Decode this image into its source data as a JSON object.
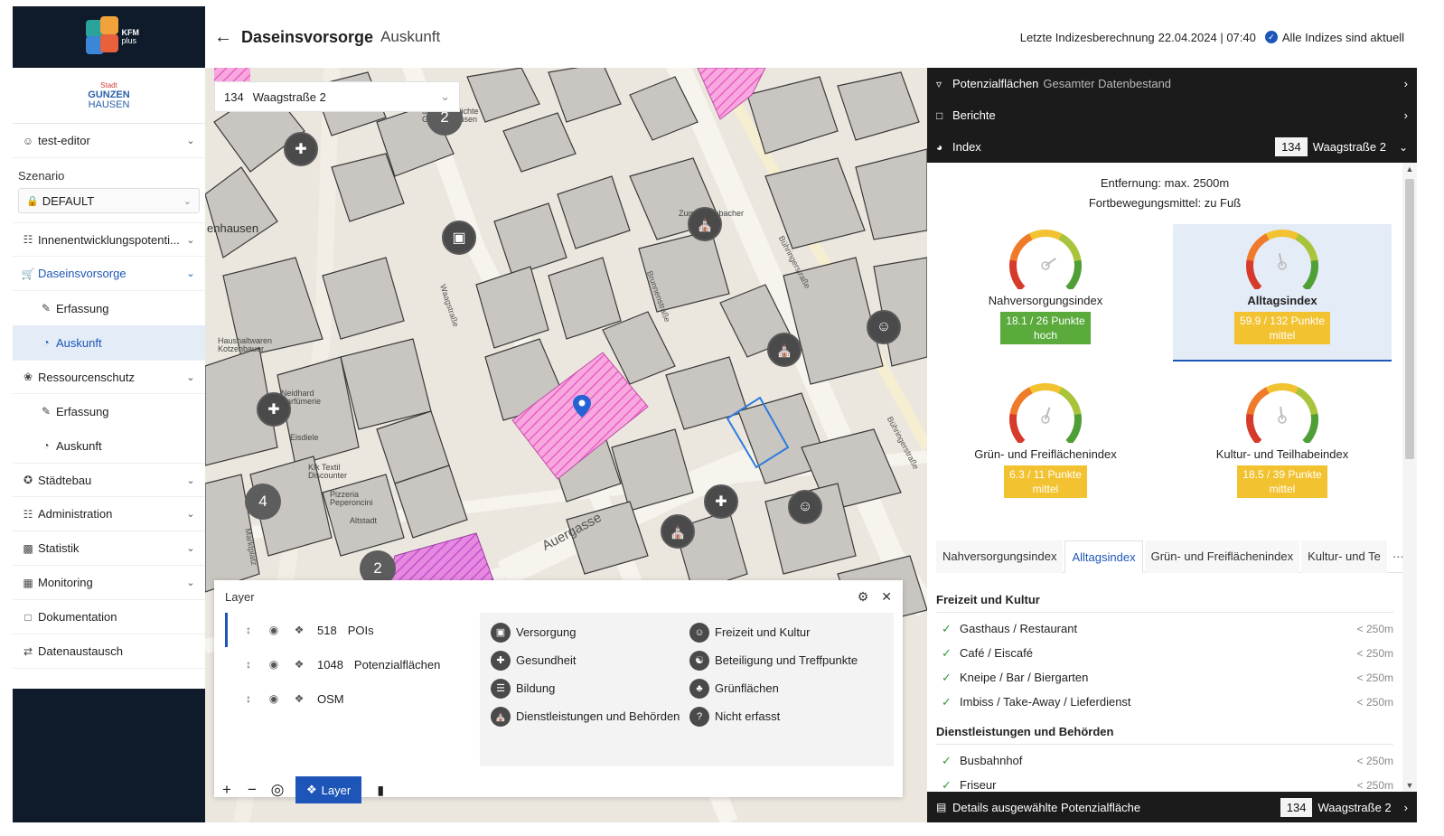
{
  "app": {
    "logo_text_1": "KFM",
    "logo_text_2": "plus",
    "city_small": "Stadt",
    "city_line1": "GUNZEN",
    "city_line2": "HAUSEN"
  },
  "sidebar": {
    "user": "test-editor",
    "scenario_label": "Szenario",
    "scenario_value": "DEFAULT",
    "items": [
      {
        "label": "Innenentwicklungspotenti..."
      },
      {
        "label": "Daseinsvorsorge"
      },
      {
        "label": "Erfassung"
      },
      {
        "label": "Auskunft"
      },
      {
        "label": "Ressourcenschutz"
      },
      {
        "label": "Erfassung"
      },
      {
        "label": "Auskunft"
      },
      {
        "label": "Städtebau"
      },
      {
        "label": "Administration"
      },
      {
        "label": "Statistik"
      },
      {
        "label": "Monitoring"
      },
      {
        "label": "Dokumentation"
      },
      {
        "label": "Datenaustausch"
      }
    ]
  },
  "header": {
    "title": "Daseinsvorsorge",
    "subtitle": "Auskunft",
    "last_calc_label": "Letzte Indizesberechnung",
    "last_calc_value": "22.04.2024 | 07:40",
    "status": "Alle Indizes sind aktuell"
  },
  "map": {
    "search_number": "134",
    "search_name": "Waagstraße 2",
    "labels": {
      "enhausen": "enhausen",
      "haushalt": "Haushaltwaren Kotzenbauer",
      "neidhard": "Neidhard Parfümerie",
      "eisdiele": "Eisdiele",
      "kik": "Kik Textil Discounter",
      "pizzeria": "Pizzeria Peperoncini",
      "altstadt": "Altstadt",
      "zum": "Zum Hafenbacher",
      "geschichte": "und Geschichte Gunzenhausen",
      "waagstr": "Waagstraße",
      "brunnenstr": "Brunnenstraße",
      "buehringer": "Bühringerstraße",
      "buehringer2": "Bühringerstraße",
      "auergasse": "Auergasse",
      "marktplatz": "Marktplatz"
    },
    "clusters": [
      "2",
      "4",
      "2"
    ]
  },
  "layer_panel": {
    "title": "Layer",
    "layers": [
      {
        "count": "518",
        "name": "POIs"
      },
      {
        "count": "1048",
        "name": "Potenzialflächen"
      },
      {
        "count": "",
        "name": "OSM"
      }
    ],
    "legend": [
      {
        "label": "Versorgung",
        "icon": "basket-icon"
      },
      {
        "label": "Freizeit und Kultur",
        "icon": "theater-icon"
      },
      {
        "label": "Gesundheit",
        "icon": "medical-icon"
      },
      {
        "label": "Beteiligung und Treffpunkte",
        "icon": "people-icon"
      },
      {
        "label": "Bildung",
        "icon": "education-icon"
      },
      {
        "label": "Grünflächen",
        "icon": "tree-icon"
      },
      {
        "label": "Dienstleistungen und Behörden",
        "icon": "building-icon"
      },
      {
        "label": "Nicht erfasst",
        "icon": "question-icon"
      }
    ],
    "layer_button": "Layer"
  },
  "right_panel": {
    "bar1_title": "Potenzialflächen",
    "bar1_sub": "Gesamter Datenbestand",
    "bar2_title": "Berichte",
    "bar3_title": "Index",
    "bar3_num": "134",
    "bar3_name": "Waagstraße 2",
    "distance": "Entfernung: max. 2500m",
    "transport": "Fortbewegungsmittel: zu Fuß",
    "gauges": [
      {
        "name": "Nahversorgungsindex",
        "points": "18.1 / 26 Punkte",
        "level": "hoch",
        "value": 0.7,
        "color": "#5aaa3c"
      },
      {
        "name": "Alltagsindex",
        "points": "59.9 / 132 Punkte",
        "level": "mittel",
        "value": 0.45,
        "color": "#f2c230"
      },
      {
        "name": "Grün- und Freiflächenindex",
        "points": "6.3 / 11 Punkte",
        "level": "mittel",
        "value": 0.57,
        "color": "#f2c230"
      },
      {
        "name": "Kultur- und Teilhabeindex",
        "points": "18.5 / 39 Punkte",
        "level": "mittel",
        "value": 0.47,
        "color": "#f2c230"
      }
    ],
    "tabs": [
      "Nahversorgungsindex",
      "Alltagsindex",
      "Grün- und Freiflächenindex",
      "Kultur- und Te",
      "···"
    ],
    "categories": [
      {
        "title": "Freizeit und Kultur",
        "items": [
          {
            "name": "Gasthaus / Restaurant",
            "dist": "< 250m"
          },
          {
            "name": "Café / Eiscafé",
            "dist": "< 250m"
          },
          {
            "name": "Kneipe / Bar / Biergarten",
            "dist": "< 250m"
          },
          {
            "name": "Imbiss / Take-Away / Lieferdienst",
            "dist": "< 250m"
          }
        ]
      },
      {
        "title": "Dienstleistungen und Behörden",
        "items": [
          {
            "name": "Busbahnhof",
            "dist": "< 250m"
          },
          {
            "name": "Friseur",
            "dist": "< 250m"
          }
        ]
      }
    ],
    "footer_title": "Details ausgewählte Potenzialfläche",
    "footer_num": "134",
    "footer_name": "Waagstraße 2"
  },
  "colors": {
    "accent": "#1d56b8",
    "dark": "#1b1b1b",
    "navy": "#0f1a2b",
    "highlight": "#f06ec8"
  }
}
